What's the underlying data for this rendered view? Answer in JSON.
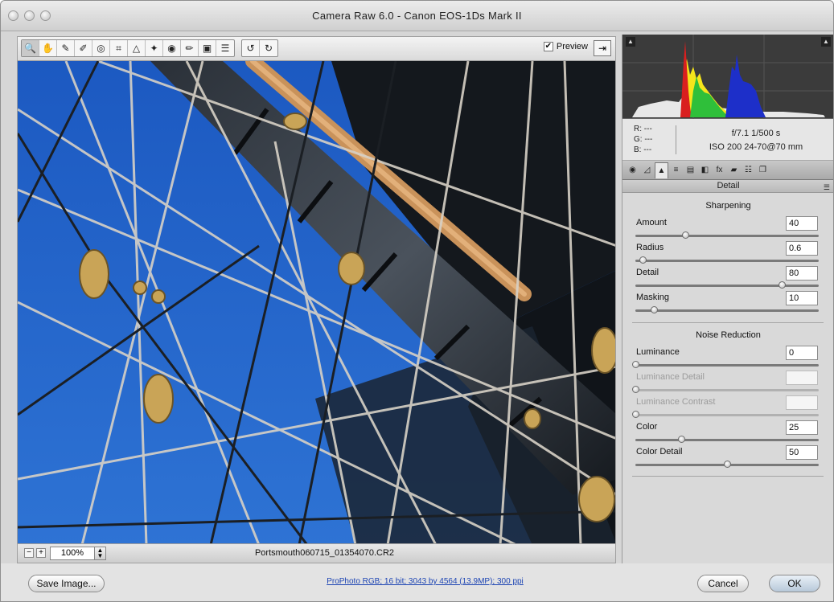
{
  "window": {
    "title": "Camera Raw 6.0  -  Canon EOS-1Ds Mark II"
  },
  "toolbar": {
    "tools": [
      {
        "icon": "zoom-icon",
        "glyph": "🔍",
        "active": true
      },
      {
        "icon": "hand-icon",
        "glyph": "✋"
      },
      {
        "icon": "white-balance-icon",
        "glyph": "✎"
      },
      {
        "icon": "color-sampler-icon",
        "glyph": "✐"
      },
      {
        "icon": "target-adjustment-icon",
        "glyph": "◎"
      },
      {
        "icon": "crop-icon",
        "glyph": "⌗"
      },
      {
        "icon": "straighten-icon",
        "glyph": "△"
      },
      {
        "icon": "spot-removal-icon",
        "glyph": "✦"
      },
      {
        "icon": "red-eye-icon",
        "glyph": "◉"
      },
      {
        "icon": "adjustment-brush-icon",
        "glyph": "✏"
      },
      {
        "icon": "graduated-filter-icon",
        "glyph": "▣"
      },
      {
        "icon": "preferences-icon",
        "glyph": "☰"
      },
      {
        "icon": "rotate-left-icon",
        "glyph": "↺"
      },
      {
        "icon": "rotate-right-icon",
        "glyph": "↻"
      }
    ],
    "preview_label": "Preview",
    "preview_checked": "✔"
  },
  "status": {
    "zoom_out_glyph": "−",
    "zoom_in_glyph": "+",
    "zoom_value": "100%",
    "filename": "Portsmouth060715_01354070.CR2"
  },
  "footer": {
    "save_label": "Save Image...",
    "workflow_link": "ProPhoto RGB; 16 bit; 3043 by 4564 (13.9MP); 300 ppi",
    "cancel_label": "Cancel",
    "ok_label": "OK"
  },
  "readout": {
    "r": "R:  ---",
    "g": "G:  ---",
    "b": "B:  ---",
    "exposure": "f/7.1   1/500 s",
    "iso_lens": "ISO 200   24-70@70 mm"
  },
  "panel": {
    "title": "Detail",
    "tabs": [
      {
        "icon": "basic-tab-icon",
        "glyph": "◉"
      },
      {
        "icon": "tone-curve-tab-icon",
        "glyph": "◿"
      },
      {
        "icon": "detail-tab-icon",
        "glyph": "▲",
        "active": true
      },
      {
        "icon": "hsl-tab-icon",
        "glyph": "≡"
      },
      {
        "icon": "split-toning-tab-icon",
        "glyph": "▤"
      },
      {
        "icon": "lens-corrections-tab-icon",
        "glyph": "◧"
      },
      {
        "icon": "effects-tab-icon",
        "glyph": "fx"
      },
      {
        "icon": "camera-calibration-tab-icon",
        "glyph": "▰"
      },
      {
        "icon": "presets-tab-icon",
        "glyph": "☷"
      },
      {
        "icon": "snapshots-tab-icon",
        "glyph": "❐"
      }
    ],
    "sharpening": {
      "title": "Sharpening",
      "sliders": [
        {
          "label": "Amount",
          "value": "40",
          "level": 0.27
        },
        {
          "label": "Radius",
          "value": "0.6",
          "level": 0.04
        },
        {
          "label": "Detail",
          "value": "80",
          "level": 0.8
        },
        {
          "label": "Masking",
          "value": "10",
          "level": 0.1
        }
      ]
    },
    "noise": {
      "title": "Noise Reduction",
      "sliders": [
        {
          "label": "Luminance",
          "value": "0",
          "level": 0.0
        },
        {
          "label": "Luminance Detail",
          "value": "",
          "level": 0.0,
          "disabled": true
        },
        {
          "label": "Luminance Contrast",
          "value": "",
          "level": 0.0,
          "disabled": true
        },
        {
          "label": "Color",
          "value": "25",
          "level": 0.25
        },
        {
          "label": "Color Detail",
          "value": "50",
          "level": 0.5
        }
      ]
    }
  }
}
